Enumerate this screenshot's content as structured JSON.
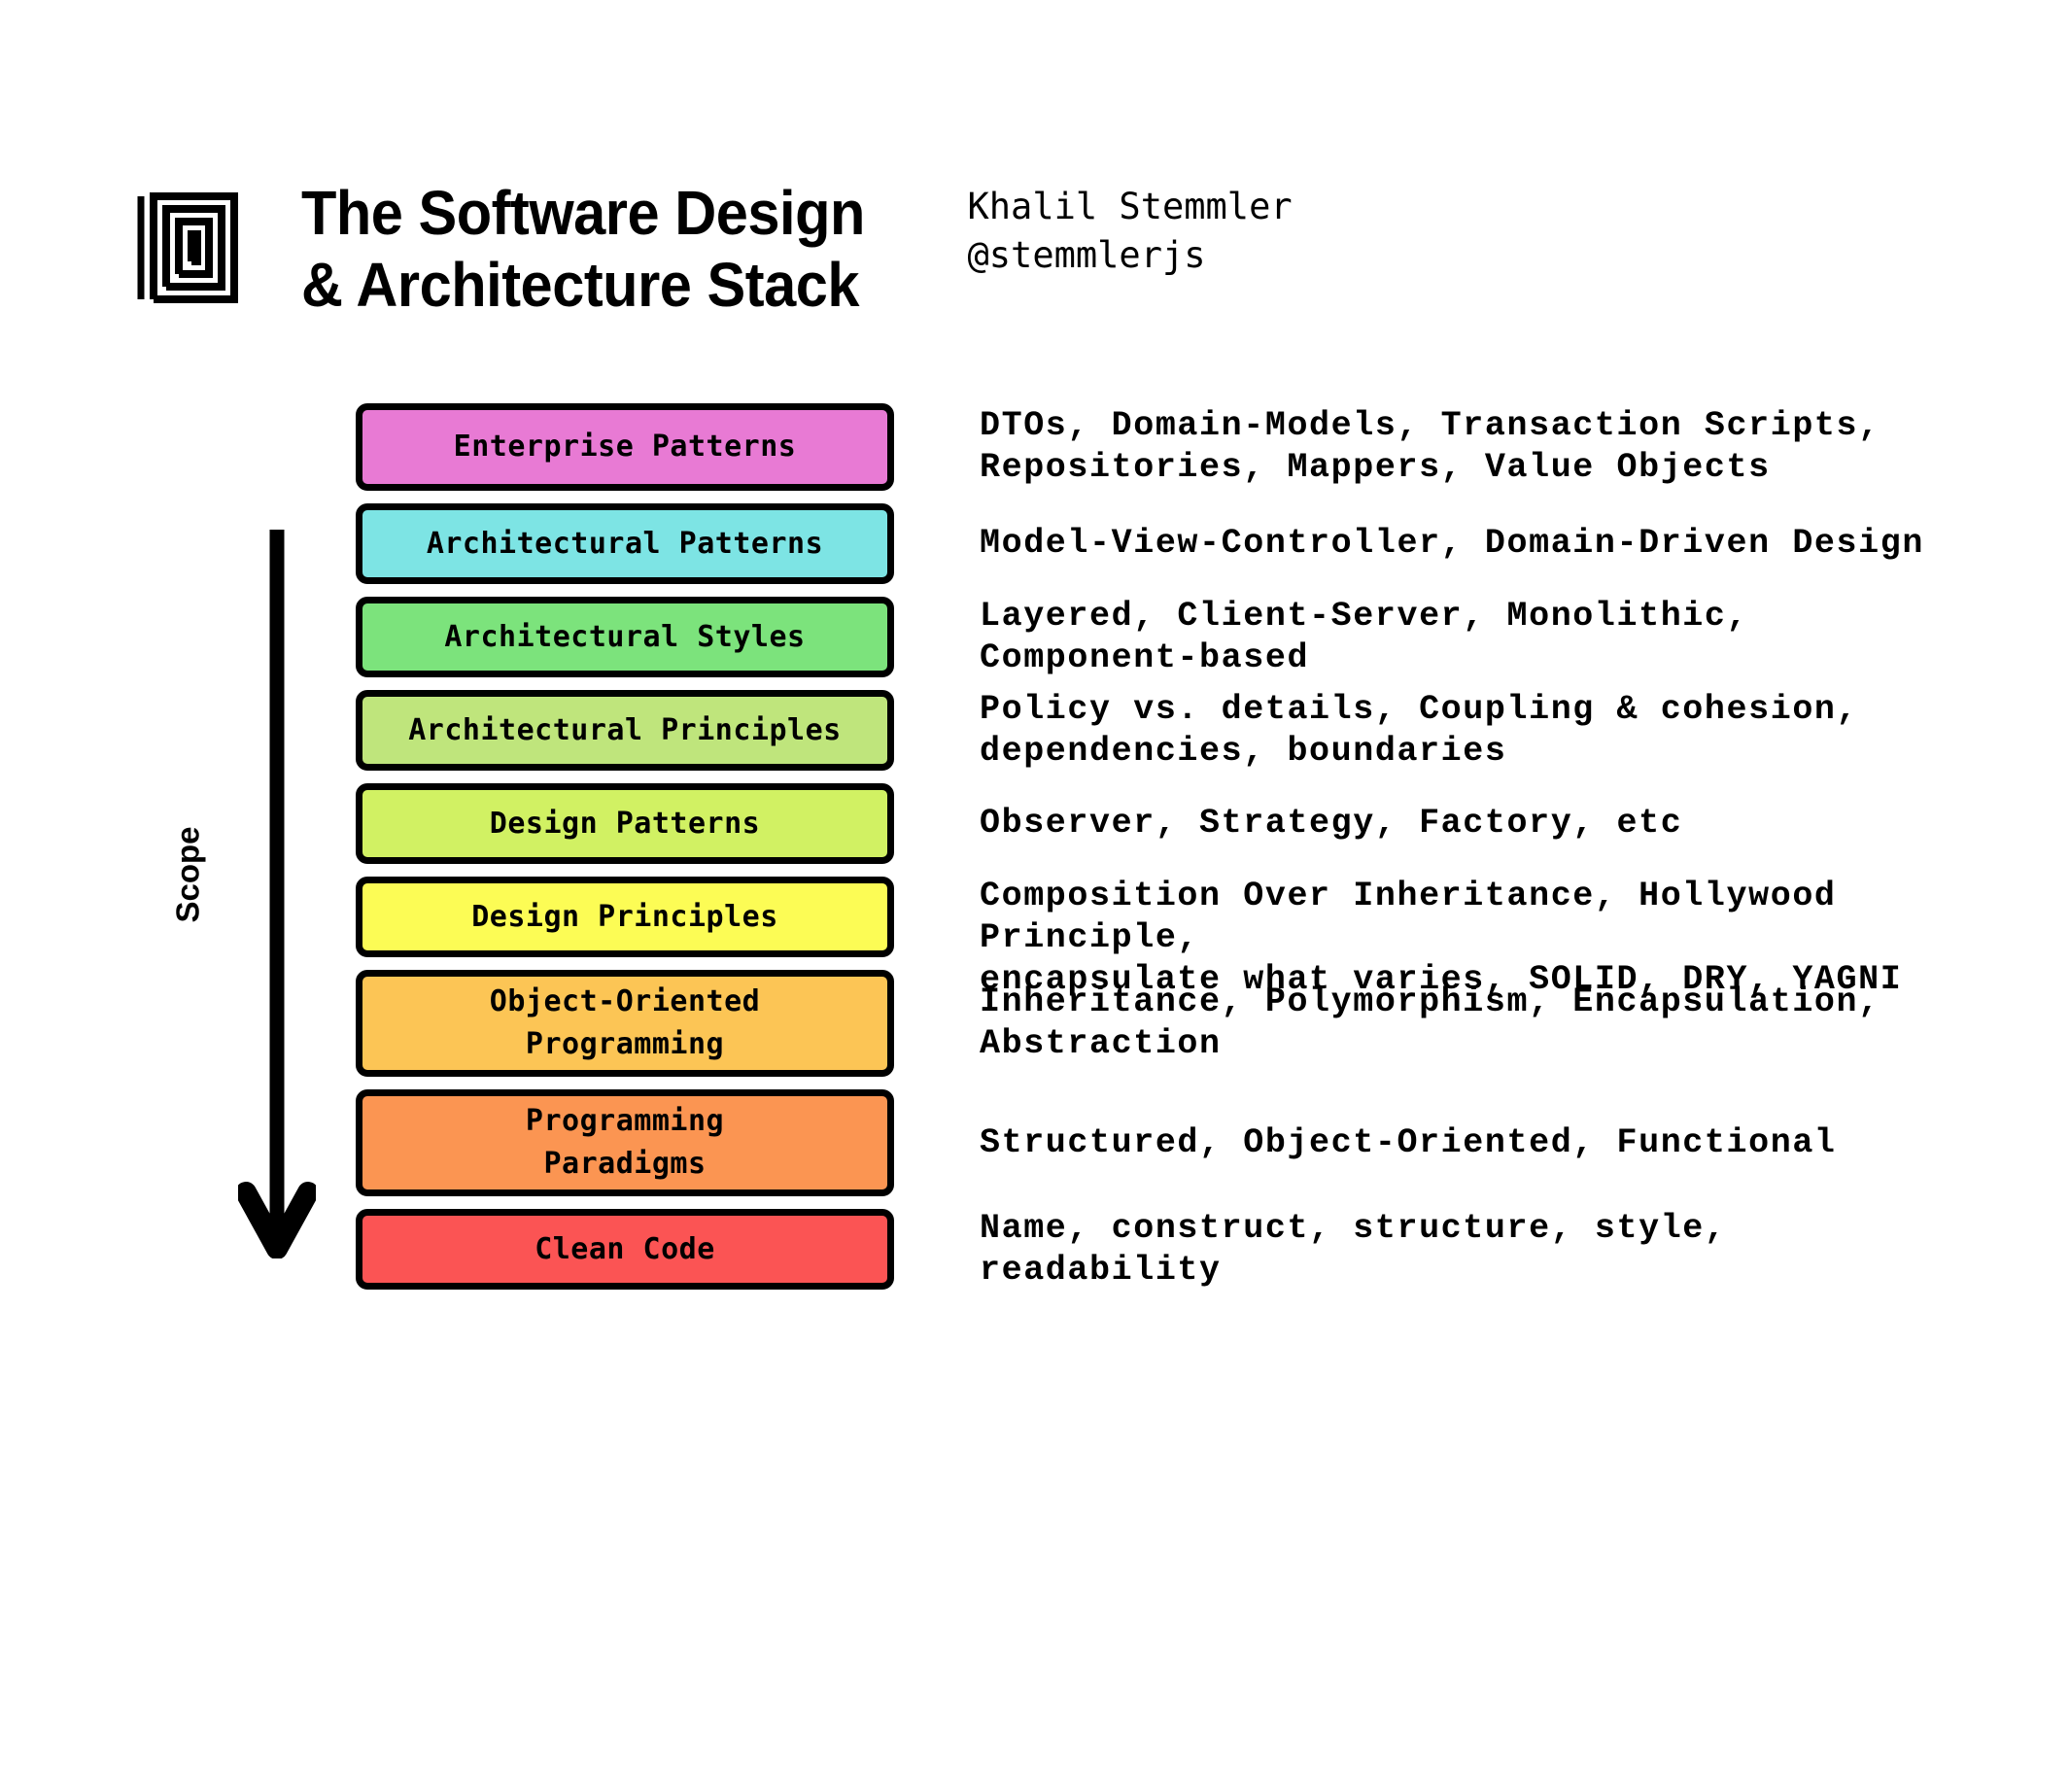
{
  "header": {
    "logo_icon": "square-spiral-logo-icon",
    "title_line_1": "The Software Design",
    "title_line_2": "& Architecture Stack",
    "author_name": "Khalil Stemmler",
    "author_handle": "@stemmlerjs"
  },
  "axis": {
    "label": "Scope",
    "arrow_icon": "down-arrow-icon",
    "direction": "down"
  },
  "colors": {
    "enterprise_patterns": "#E87AD4",
    "architectural_patterns": "#7DE4E4",
    "architectural_styles": "#7CE37C",
    "architectural_principles": "#BFE57C",
    "design_patterns": "#D1F163",
    "design_principles": "#FCFC55",
    "object_oriented_programming": "#FCC555",
    "programming_paradigms": "#FB9552",
    "clean_code": "#FB5454",
    "border": "#000000",
    "background": "#FFFFFF",
    "text": "#000000"
  },
  "chart_data": {
    "type": "table",
    "title": "The Software Design & Architecture Stack",
    "layers": [
      {
        "label": "Enterprise Patterns",
        "color": "#E87AD4",
        "height": 90,
        "description": "DTOs, Domain-Models, Transaction Scripts,\nRepositories, Mappers, Value Objects"
      },
      {
        "label": "Architectural Patterns",
        "color": "#7DE4E4",
        "height": 83,
        "description": "Model-View-Controller, Domain-Driven Design"
      },
      {
        "label": "Architectural Styles",
        "color": "#7CE37C",
        "height": 83,
        "description": "Layered, Client-Server, Monolithic,\nComponent-based"
      },
      {
        "label": "Architectural Principles",
        "color": "#BFE57C",
        "height": 83,
        "description": "Policy vs. details, Coupling & cohesion,\ndependencies, boundaries"
      },
      {
        "label": "Design Patterns",
        "color": "#D1F163",
        "height": 83,
        "description": "Observer, Strategy, Factory, etc"
      },
      {
        "label": "Design Principles",
        "color": "#FCFC55",
        "height": 83,
        "description": "Composition Over Inheritance, Hollywood Principle,\nencapsulate what varies, SOLID, DRY, YAGNI"
      },
      {
        "label": "Object-Oriented\nProgramming",
        "color": "#FCC555",
        "height": 110,
        "description": "Inheritance, Polymorphism, Encapsulation,\nAbstraction"
      },
      {
        "label": "Programming\nParadigms",
        "color": "#FB9552",
        "height": 110,
        "description": "Structured, Object-Oriented, Functional"
      },
      {
        "label": "Clean Code",
        "color": "#FB5454",
        "height": 83,
        "description": "Name, construct, structure, style,\nreadability"
      }
    ]
  }
}
